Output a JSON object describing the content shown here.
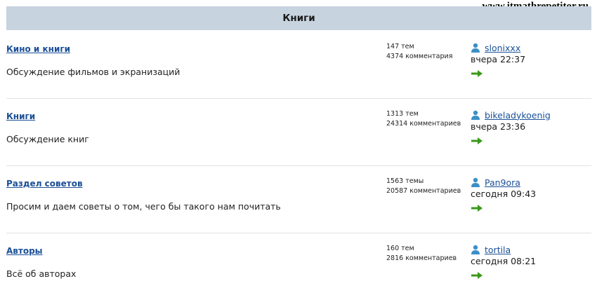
{
  "watermark": "www.itmathrepetitor.ru",
  "section": {
    "title": "Книги"
  },
  "forums": [
    {
      "title": "Кино и книги",
      "description": "Обсуждение фильмов и экранизаций",
      "topics": "147 тем",
      "comments": "4374 комментария",
      "last_author": "slonixxx",
      "last_time": "вчера 22:37"
    },
    {
      "title": "Книги",
      "description": "Обсуждение книг",
      "topics": "1313 тем",
      "comments": "24314 комментариев",
      "last_author": "bikeladykoenig",
      "last_time": "вчера 23:36"
    },
    {
      "title": "Раздел советов",
      "description": "Просим и даем советы о том, чего бы такого нам почитать",
      "topics": "1563 темы",
      "comments": "20587 комментариев",
      "last_author": "Pan9ora",
      "last_time": "сегодня 09:43"
    },
    {
      "title": "Авторы",
      "description": "Всё об авторах",
      "topics": "160 тем",
      "comments": "2816 комментариев",
      "last_author": "tortila",
      "last_time": "сегодня 08:21"
    }
  ],
  "icons": {
    "user": "user-icon",
    "goto": "arrow-right-icon"
  },
  "colors": {
    "header_bg": "#c8d3e0",
    "link": "#1a4f96",
    "arrow": "#3a9a1a",
    "user_icon": "#3b8fc8"
  }
}
